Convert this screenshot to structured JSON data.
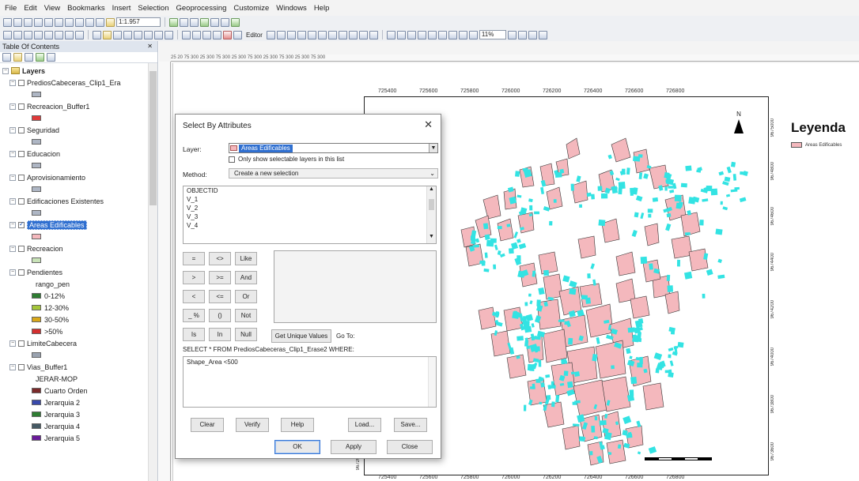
{
  "menu": [
    "File",
    "Edit",
    "View",
    "Bookmarks",
    "Insert",
    "Selection",
    "Geoprocessing",
    "Customize",
    "Windows",
    "Help"
  ],
  "toolbar": {
    "scale": "1:1.957",
    "zoom_percent": "11%",
    "editor_label": "Editor"
  },
  "toc": {
    "title": "Table Of Contents",
    "close": "✕",
    "root": "Layers",
    "layers": [
      {
        "name": "PrediosCabeceras_Clip1_Era",
        "checked": false,
        "swatch": "#aeb6c4"
      },
      {
        "name": "Recreacion_Buffer1",
        "checked": false,
        "swatch": "#e03a3a"
      },
      {
        "name": "Seguridad",
        "checked": false,
        "swatch": "#aeb6c4"
      },
      {
        "name": "Educacion",
        "checked": false,
        "swatch": "#aeb6c4"
      },
      {
        "name": "Aprovisionamiento",
        "checked": false,
        "swatch": "#aeb6c4"
      },
      {
        "name": "Edificaciones Existentes",
        "checked": false,
        "swatch": "#aeb6c4"
      },
      {
        "name": "Areas Edificables",
        "checked": true,
        "swatch": "#f4b8bd",
        "selected": true
      },
      {
        "name": "Recreacion",
        "checked": false,
        "swatch": "#c9e3b8"
      },
      {
        "name": "Pendientes",
        "checked": false,
        "field": "rango_pen",
        "classes": [
          {
            "label": "0-12%",
            "color": "#2e7d32"
          },
          {
            "label": "12-30%",
            "color": "#a4c639"
          },
          {
            "label": "30-50%",
            "color": "#d9a81a"
          },
          {
            "label": ">50%",
            "color": "#d32f2f"
          }
        ]
      },
      {
        "name": "LimiteCabecera",
        "checked": false,
        "swatch": "#9aa3b0"
      },
      {
        "name": "Vias_Buffer1",
        "checked": false,
        "field": "JERAR-MOP",
        "classes": [
          {
            "label": "Cuarto Orden",
            "color": "#7b2a2a"
          },
          {
            "label": "Jerarquia 2",
            "color": "#3949ab"
          },
          {
            "label": "Jerarquia 3",
            "color": "#2e7d32"
          },
          {
            "label": "Jerarquia 4",
            "color": "#455a64"
          },
          {
            "label": "Jerarquia 5",
            "color": "#6a1b9a"
          }
        ]
      }
    ]
  },
  "ruler_top": "25 20 75 300 25 300 75 300 25 300 75 300 25 300 75 300 25 300 75 300",
  "map": {
    "coords_top": [
      "725400",
      "725600",
      "725800",
      "726000",
      "726200",
      "726400",
      "726600",
      "726800"
    ],
    "coords_bottom": [
      "725400",
      "725600",
      "725800",
      "726000",
      "726200",
      "726400",
      "726600",
      "726800"
    ],
    "coords_right": [
      "9675000",
      "9674800",
      "9674600",
      "9674400",
      "9674200",
      "9674000",
      "9673800",
      "9673600"
    ],
    "coords_left": [
      "9672600"
    ],
    "north_label": "N",
    "legend_title": "Leyenda",
    "legend_item": "Areas Edificables",
    "colors": {
      "parcel_fill": "#f4b8bd",
      "parcel_stroke": "#333333",
      "building_fill": "#33e3e3"
    }
  },
  "dialog": {
    "title": "Select By Attributes",
    "close": "✕",
    "layer_label": "Layer:",
    "layer_value": "Areas Edificables",
    "only_selectable": "Only show selectable layers in this list",
    "method_label": "Method:",
    "method_value": "Create a new selection",
    "fields": [
      "OBJECTID",
      "V_1",
      "V_2",
      "V_3",
      "V_4"
    ],
    "operators": [
      "=",
      "<>",
      "Like",
      ">",
      ">=",
      "And",
      "<",
      "<=",
      "Or",
      "_ %",
      "()",
      "Not",
      "Is",
      "In",
      "Null"
    ],
    "unique_values_btn": "Get Unique Values",
    "goto_label": "Go To:",
    "sql_prefix": "SELECT * FROM PrediosCabeceras_Clip1_Erase2 WHERE:",
    "expression": "Shape_Area <500",
    "buttons": {
      "clear": "Clear",
      "verify": "Verify",
      "help": "Help",
      "load": "Load...",
      "save": "Save...",
      "ok": "OK",
      "apply": "Apply",
      "close": "Close"
    }
  }
}
